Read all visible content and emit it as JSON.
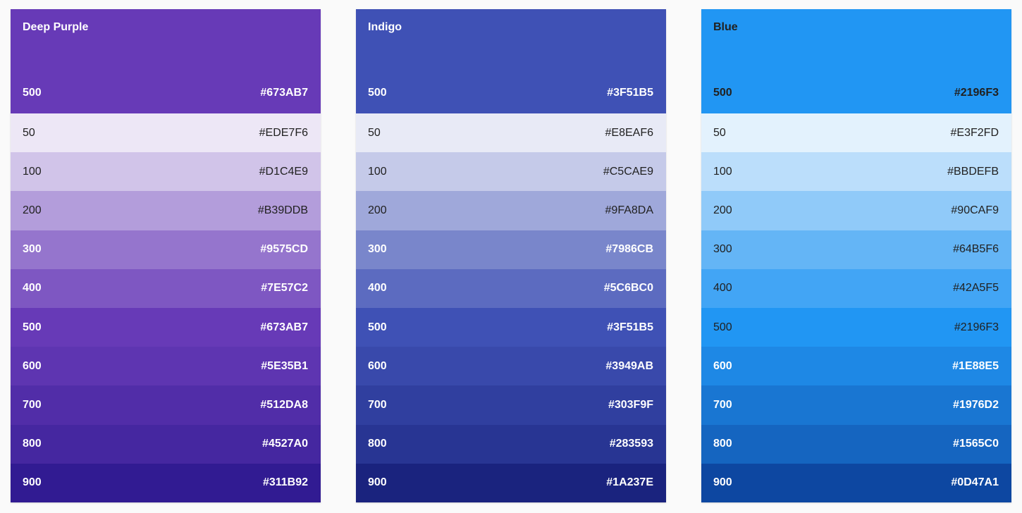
{
  "palettes": [
    {
      "name": "Deep Purple",
      "main": {
        "shade": "500",
        "hex": "#673AB7",
        "text": "dark"
      },
      "swatches": [
        {
          "shade": "50",
          "hex": "#EDE7F6",
          "text": "light"
        },
        {
          "shade": "100",
          "hex": "#D1C4E9",
          "text": "light"
        },
        {
          "shade": "200",
          "hex": "#B39DDB",
          "text": "light"
        },
        {
          "shade": "300",
          "hex": "#9575CD",
          "text": "dark"
        },
        {
          "shade": "400",
          "hex": "#7E57C2",
          "text": "dark"
        },
        {
          "shade": "500",
          "hex": "#673AB7",
          "text": "dark"
        },
        {
          "shade": "600",
          "hex": "#5E35B1",
          "text": "dark"
        },
        {
          "shade": "700",
          "hex": "#512DA8",
          "text": "dark"
        },
        {
          "shade": "800",
          "hex": "#4527A0",
          "text": "dark"
        },
        {
          "shade": "900",
          "hex": "#311B92",
          "text": "dark"
        }
      ]
    },
    {
      "name": "Indigo",
      "main": {
        "shade": "500",
        "hex": "#3F51B5",
        "text": "dark"
      },
      "swatches": [
        {
          "shade": "50",
          "hex": "#E8EAF6",
          "text": "light"
        },
        {
          "shade": "100",
          "hex": "#C5CAE9",
          "text": "light"
        },
        {
          "shade": "200",
          "hex": "#9FA8DA",
          "text": "light"
        },
        {
          "shade": "300",
          "hex": "#7986CB",
          "text": "dark"
        },
        {
          "shade": "400",
          "hex": "#5C6BC0",
          "text": "dark"
        },
        {
          "shade": "500",
          "hex": "#3F51B5",
          "text": "dark"
        },
        {
          "shade": "600",
          "hex": "#3949AB",
          "text": "dark"
        },
        {
          "shade": "700",
          "hex": "#303F9F",
          "text": "dark"
        },
        {
          "shade": "800",
          "hex": "#283593",
          "text": "dark"
        },
        {
          "shade": "900",
          "hex": "#1A237E",
          "text": "dark"
        }
      ]
    },
    {
      "name": "Blue",
      "main": {
        "shade": "500",
        "hex": "#2196F3",
        "text": "light"
      },
      "swatches": [
        {
          "shade": "50",
          "hex": "#E3F2FD",
          "text": "light"
        },
        {
          "shade": "100",
          "hex": "#BBDEFB",
          "text": "light"
        },
        {
          "shade": "200",
          "hex": "#90CAF9",
          "text": "light"
        },
        {
          "shade": "300",
          "hex": "#64B5F6",
          "text": "light"
        },
        {
          "shade": "400",
          "hex": "#42A5F5",
          "text": "light"
        },
        {
          "shade": "500",
          "hex": "#2196F3",
          "text": "light"
        },
        {
          "shade": "600",
          "hex": "#1E88E5",
          "text": "dark"
        },
        {
          "shade": "700",
          "hex": "#1976D2",
          "text": "dark"
        },
        {
          "shade": "800",
          "hex": "#1565C0",
          "text": "dark"
        },
        {
          "shade": "900",
          "hex": "#0D47A1",
          "text": "dark"
        }
      ]
    }
  ]
}
